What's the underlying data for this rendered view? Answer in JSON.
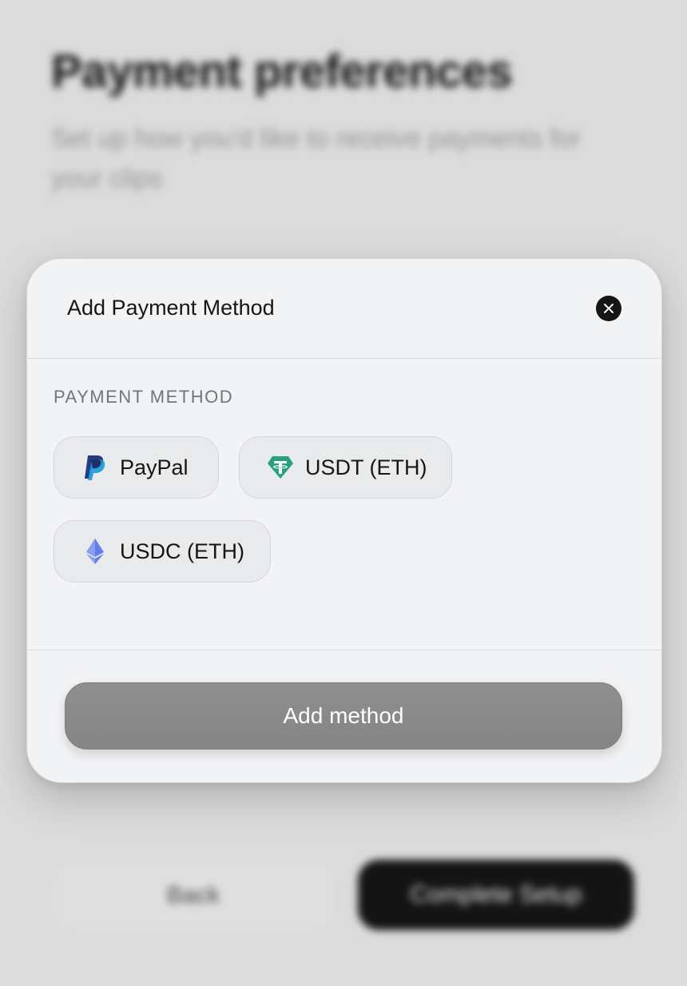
{
  "background": {
    "title": "Payment preferences",
    "subtitle": "Set up how you'd like to receive payments for your clips",
    "back_label": "Back",
    "complete_label": "Complete Setup"
  },
  "modal": {
    "title": "Add Payment Method",
    "close_icon": "close-icon",
    "section_label": "PAYMENT METHOD",
    "methods": [
      {
        "label": "PayPal",
        "icon": "paypal-icon",
        "color": "#253B80"
      },
      {
        "label": "USDT (ETH)",
        "icon": "tether-icon",
        "color": "#26A17B"
      },
      {
        "label": "USDC (ETH)",
        "icon": "ethereum-icon",
        "color": "#627EEA"
      }
    ],
    "submit_label": "Add method"
  }
}
